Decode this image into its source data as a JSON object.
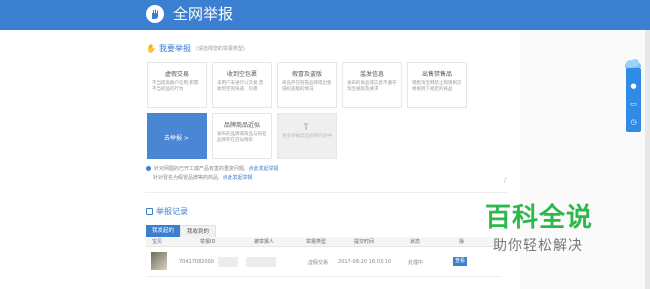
{
  "header": {
    "title": "全网举报"
  },
  "report_section": {
    "title": "我要举报",
    "hint": "(请选择您的举报类型)"
  },
  "cards": [
    {
      "title": "虚假交易",
      "desc": "不当提高账户信用,积累不当权益的行为"
    },
    {
      "title": "收到空包裹",
      "desc": "未用户未进行以交易,曾收到空的快递、包裹"
    },
    {
      "title": "假冒及盗版",
      "desc": "商品存在假冒品牌或出售侵权盗版的情况"
    },
    {
      "title": "滥发信息",
      "desc": "发布的商品或信息不遵守淘宝规则及要求"
    },
    {
      "title": "出售禁售品",
      "desc": "销售淘宝网禁止和限制交易规则下规定的商品"
    },
    {
      "title": "去举报 >",
      "desc": ""
    },
    {
      "title": "品牌商品近似",
      "desc": "发布的品牌或商品与知名品牌存在近似情形"
    },
    {
      "title": "",
      "desc": "更多举报类型即将开放中"
    }
  ],
  "notes": [
    {
      "text": "针对网图的已开工或产品有害的重复问题,",
      "link": "点此发起举报"
    },
    {
      "text": "针对冒名为假冒品牌等的商品,",
      "link": "点此发起举报"
    }
  ],
  "records": {
    "title": "举报记录",
    "tabs": [
      "我发起的",
      "我收到的"
    ],
    "columns": [
      "宝贝",
      "举报ID",
      "被举报人",
      "举报类型",
      "提交时间",
      "状态",
      "操"
    ],
    "rows": [
      {
        "id": "70417082000",
        "type": "虚假交易",
        "time": "2017-08-20 16:03:10",
        "status": "处理中",
        "action": "查看"
      }
    ]
  },
  "watermark": {
    "main": "百科全说",
    "sub": "助你轻松解决",
    "mark": "/"
  },
  "colors": {
    "primary": "#3a7fd0",
    "brand_green": "#2db84b"
  },
  "side_icons": [
    "cloud-icon",
    "drop-icon",
    "message-icon",
    "clock-icon"
  ]
}
